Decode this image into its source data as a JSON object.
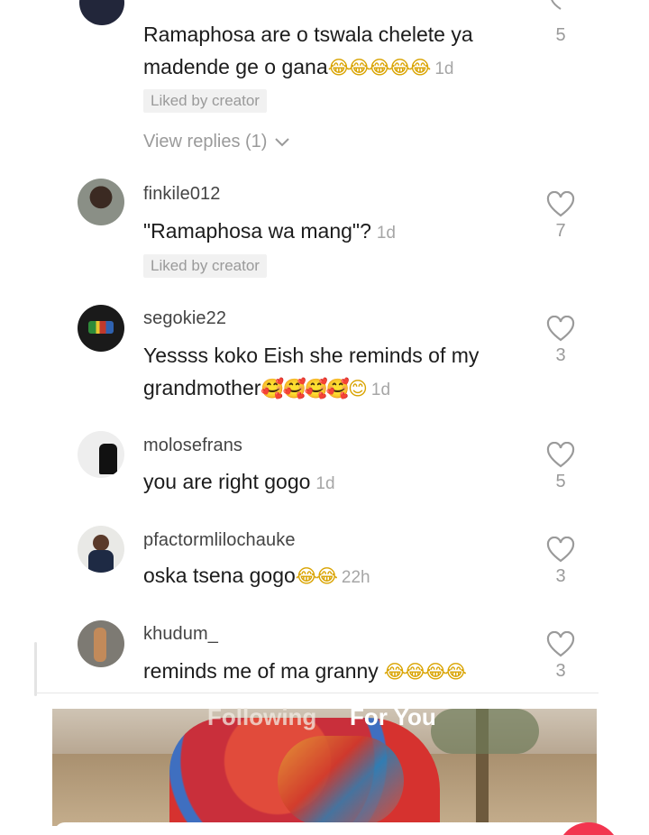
{
  "comments": [
    {
      "username": "",
      "text": "Ramaphosa are o tswala chelete ya madende ge o gana",
      "emojis": "😂😂😂😂😂",
      "time": "1d",
      "liked_label": "Liked by creator",
      "view_replies": "View replies (1)",
      "likes": "5"
    },
    {
      "username": "finkile012",
      "text": "\"Ramaphosa wa mang\"?",
      "emojis": "",
      "time": "1d",
      "liked_label": "Liked by creator",
      "likes": "7"
    },
    {
      "username": "segokie22",
      "text": "Yessss koko Eish she reminds of my grandmother",
      "emojis": "🥰🥰🥰🥰😊",
      "time": "1d",
      "likes": "3"
    },
    {
      "username": "molosefrans",
      "text": "you are right gogo",
      "emojis": "",
      "time": "1d",
      "likes": "5"
    },
    {
      "username": "pfactormlilochauke",
      "text": "oska tsena gogo",
      "emojis": "😂😂",
      "time": "22h",
      "likes": "3"
    },
    {
      "username": "khudum_",
      "text": "reminds me of ma granny",
      "emojis": "😂😂😂😂",
      "time": "",
      "likes": "3"
    }
  ],
  "video": {
    "tabs": [
      "Following",
      "For You"
    ]
  },
  "colors": {
    "accent_red": "#f2354f",
    "muted_text": "#9a9a9a"
  }
}
